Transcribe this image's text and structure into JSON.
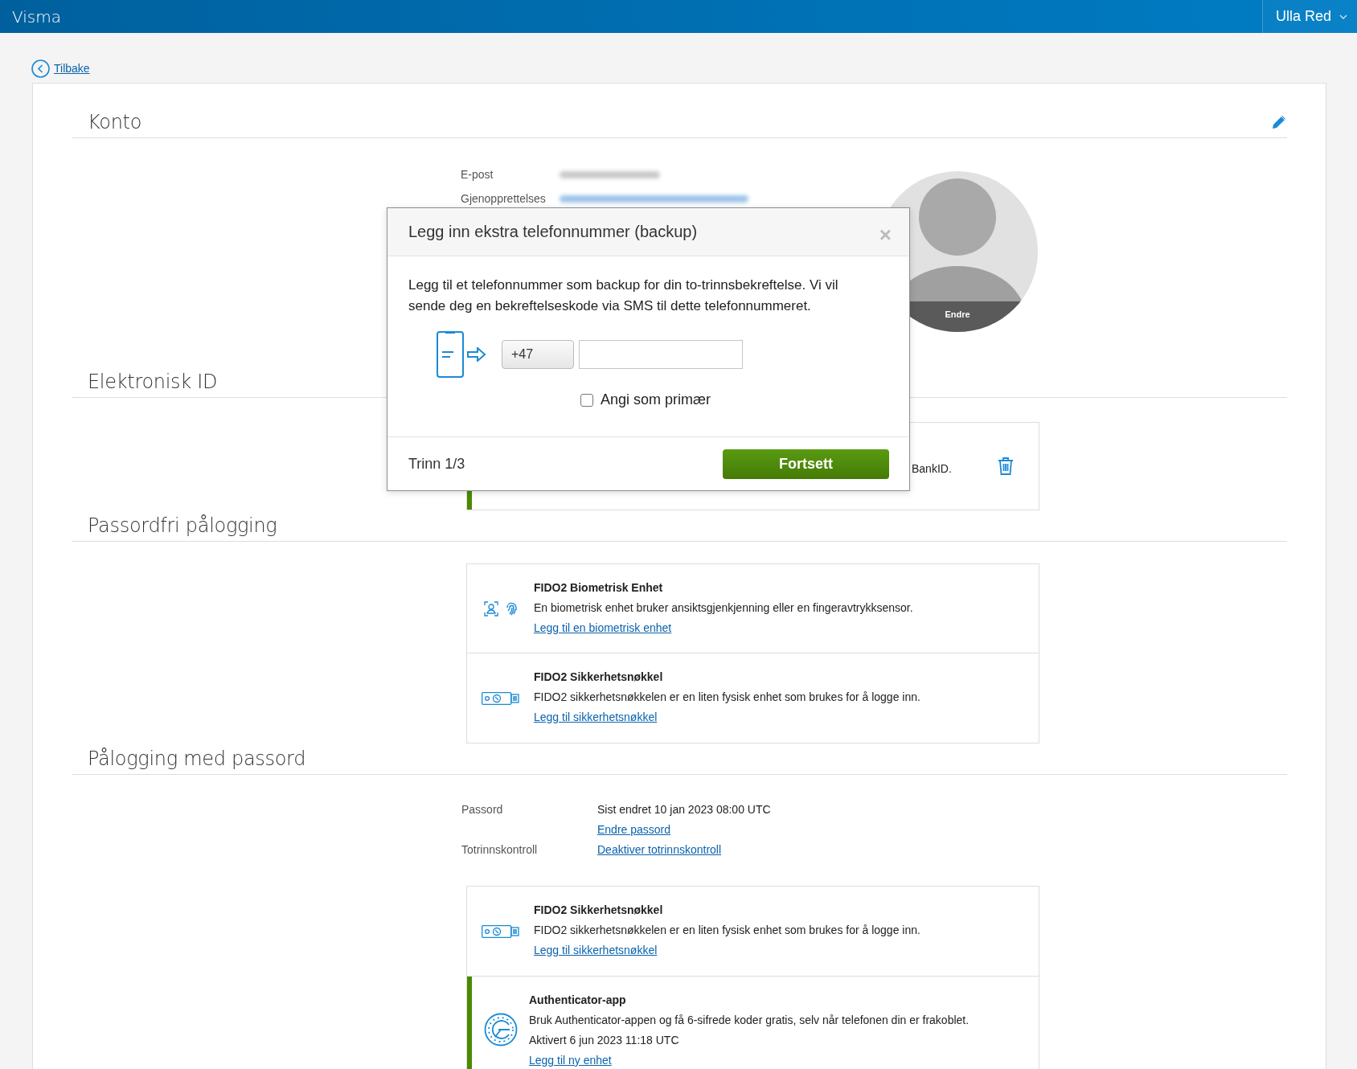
{
  "header": {
    "brand": "Visma",
    "user": "Ulla Red"
  },
  "back_link": "Tilbake",
  "sections": [
    {
      "kind": "account",
      "title": "Konto",
      "fields": [
        {
          "label": "E-post",
          "kind": "text",
          "redacted": true
        },
        {
          "label": "Gjenopprettelses",
          "kind": "link",
          "redacted": true
        }
      ],
      "avatar": {
        "action": "Endre"
      }
    },
    {
      "kind": "eid",
      "title": "Elektronisk ID",
      "methods": [
        {
          "kind": "eid",
          "description": "BankID.",
          "active": true,
          "deletable": true
        }
      ]
    },
    {
      "kind": "methods",
      "title": "Passordfri pålogging",
      "methods": [
        {
          "kind": "biometric",
          "title": "FIDO2 Biometrisk Enhet",
          "description": "En biometrisk enhet bruker ansiktsgjenkjenning eller en fingeravtrykksensor.",
          "link": "Legg til en biometrisk enhet",
          "active": false
        },
        {
          "kind": "key",
          "title": "FIDO2 Sikkerhetsnøkkel",
          "description": "FIDO2 sikkerhetsnøkkelen er en liten fysisk enhet som brukes for å logge inn.",
          "link": "Legg til sikkerhetsnøkkel",
          "active": false
        }
      ]
    },
    {
      "kind": "password",
      "title": "Pålogging med passord",
      "rows": [
        {
          "label": "Passord",
          "value": "Sist endret 10 jan 2023 08:00 UTC",
          "link": "Endre passord"
        },
        {
          "label": "Totrinnskontroll",
          "link": "Deaktiver totrinnskontroll"
        }
      ],
      "methods": [
        {
          "kind": "key",
          "title": "FIDO2 Sikkerhetsnøkkel",
          "description": "FIDO2 sikkerhetsnøkkelen er en liten fysisk enhet som brukes for å logge inn.",
          "link": "Legg til sikkerhetsnøkkel",
          "active": false
        },
        {
          "kind": "authenticator",
          "title": "Authenticator-app",
          "description": "Bruk Authenticator-appen og få 6-sifrede koder gratis, selv når telefonen din er frakoblet.",
          "activated": "Aktivert 6 jun 2023 11:18 UTC",
          "link": "Legg til ny enhet",
          "active": true
        }
      ]
    }
  ],
  "modal": {
    "title": "Legg inn ekstra telefonnummer (backup)",
    "close": "×",
    "text": "Legg til et telefonnummer som backup for din to-trinnsbekreftelse. Vi vil sende deg en bekreftelseskode via SMS til dette telefonnummeret.",
    "country_code": "+47",
    "checkbox": {
      "label": "Angi som primær",
      "checked": false
    },
    "step": "Trinn 1/3",
    "button": "Fortsett"
  }
}
